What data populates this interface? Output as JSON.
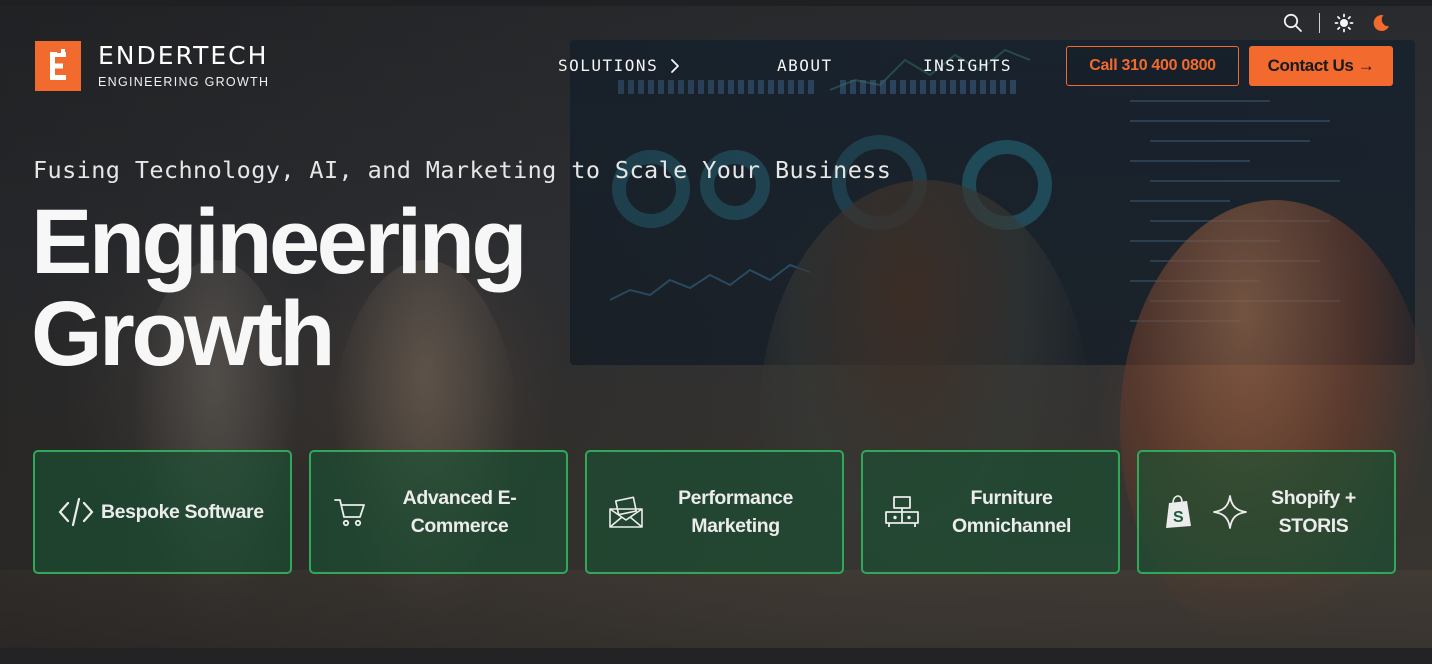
{
  "brand": {
    "name": "ENDERTECH",
    "tagline": "ENGINEERING GROWTH",
    "accent_color": "#f26a2e",
    "card_border_color": "#2fa85a"
  },
  "utility": {
    "search_icon": "search-icon",
    "light_mode_icon": "sun-icon",
    "dark_mode_icon": "moon-icon"
  },
  "nav": {
    "items": [
      {
        "label": "SOLUTIONS",
        "has_submenu": true
      },
      {
        "label": "ABOUT"
      },
      {
        "label": "INSIGHTS"
      }
    ]
  },
  "cta": {
    "call_label": "Call 310 400 0800",
    "contact_label": "Contact Us →"
  },
  "hero": {
    "subtitle": "Fusing Technology, AI, and Marketing to Scale Your Business",
    "headline_line1": "Engineering",
    "headline_line2": "Growth"
  },
  "services": [
    {
      "label": "Bespoke Software",
      "icon": "code-icon"
    },
    {
      "label": "Advanced E-Commerce",
      "icon": "cart-icon"
    },
    {
      "label": "Performance Marketing",
      "icon": "envelope-icon"
    },
    {
      "label": "Furniture Omnichannel",
      "icon": "furniture-icon"
    },
    {
      "label": "Shopify + STORIS",
      "icons": [
        "shopify-icon",
        "sparkle-icon"
      ]
    }
  ]
}
